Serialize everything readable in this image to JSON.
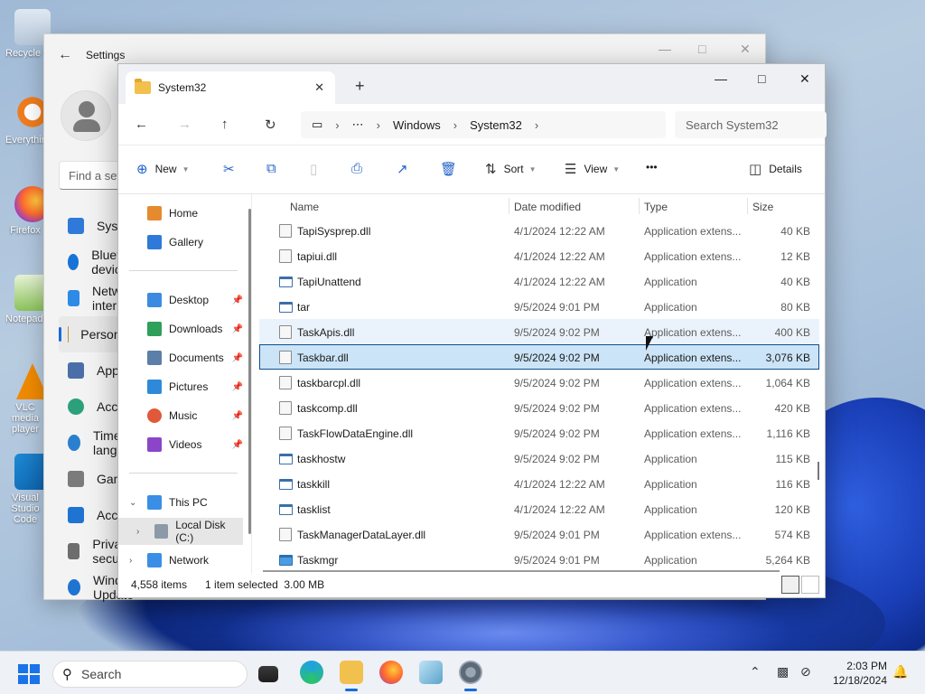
{
  "desktop": {
    "icons": [
      {
        "label": "Recycle Bin"
      },
      {
        "label": "Everything"
      },
      {
        "label": "Firefox"
      },
      {
        "label": "Notepad++"
      },
      {
        "label": "VLC media player"
      },
      {
        "label": "Visual Studio Code"
      }
    ]
  },
  "settings": {
    "title": "Settings",
    "search_placeholder": "Find a setting",
    "nav": [
      {
        "label": "System"
      },
      {
        "label": "Bluetooth & devices"
      },
      {
        "label": "Network & internet"
      },
      {
        "label": "Personalization"
      },
      {
        "label": "Apps"
      },
      {
        "label": "Accounts"
      },
      {
        "label": "Time & language"
      },
      {
        "label": "Gaming"
      },
      {
        "label": "Accessibility"
      },
      {
        "label": "Privacy & security"
      },
      {
        "label": "Windows Update"
      }
    ]
  },
  "explorer": {
    "tab_title": "System32",
    "breadcrumb": [
      "Windows",
      "System32"
    ],
    "search_placeholder": "Search System32",
    "toolbar": {
      "new": "New",
      "sort": "Sort",
      "view": "View",
      "more": "•••",
      "details": "Details"
    },
    "nav": {
      "home": "Home",
      "gallery": "Gallery",
      "desktop": "Desktop",
      "downloads": "Downloads",
      "documents": "Documents",
      "pictures": "Pictures",
      "music": "Music",
      "videos": "Videos",
      "thispc": "This PC",
      "localdisk": "Local Disk (C:)",
      "network": "Network"
    },
    "columns": {
      "name": "Name",
      "date": "Date modified",
      "type": "Type",
      "size": "Size"
    },
    "rows": [
      {
        "name": "TapiSysprep.dll",
        "date": "4/1/2024 12:22 AM",
        "type": "Application extens...",
        "size": "40 KB"
      },
      {
        "name": "tapiui.dll",
        "date": "4/1/2024 12:22 AM",
        "type": "Application extens...",
        "size": "12 KB"
      },
      {
        "name": "TapiUnattend",
        "date": "4/1/2024 12:22 AM",
        "type": "Application",
        "size": "40 KB"
      },
      {
        "name": "tar",
        "date": "9/5/2024 9:01 PM",
        "type": "Application",
        "size": "80 KB"
      },
      {
        "name": "TaskApis.dll",
        "date": "9/5/2024 9:02 PM",
        "type": "Application extens...",
        "size": "400 KB"
      },
      {
        "name": "Taskbar.dll",
        "date": "9/5/2024 9:02 PM",
        "type": "Application extens...",
        "size": "3,076 KB"
      },
      {
        "name": "taskbarcpl.dll",
        "date": "9/5/2024 9:02 PM",
        "type": "Application extens...",
        "size": "1,064 KB"
      },
      {
        "name": "taskcomp.dll",
        "date": "9/5/2024 9:02 PM",
        "type": "Application extens...",
        "size": "420 KB"
      },
      {
        "name": "TaskFlowDataEngine.dll",
        "date": "9/5/2024 9:02 PM",
        "type": "Application extens...",
        "size": "1,116 KB"
      },
      {
        "name": "taskhostw",
        "date": "9/5/2024 9:02 PM",
        "type": "Application",
        "size": "115 KB"
      },
      {
        "name": "taskkill",
        "date": "4/1/2024 12:22 AM",
        "type": "Application",
        "size": "116 KB"
      },
      {
        "name": "tasklist",
        "date": "4/1/2024 12:22 AM",
        "type": "Application",
        "size": "120 KB"
      },
      {
        "name": "TaskManagerDataLayer.dll",
        "date": "9/5/2024 9:01 PM",
        "type": "Application extens...",
        "size": "574 KB"
      },
      {
        "name": "Taskmgr",
        "date": "9/5/2024 9:01 PM",
        "type": "Application",
        "size": "5,264 KB"
      }
    ],
    "status": {
      "count": "4,558 items",
      "selection": "1 item selected  3.00 MB"
    }
  },
  "taskbar": {
    "search_placeholder": "Search",
    "time": "2:03 PM",
    "date": "12/18/2024"
  },
  "colors": {
    "accent": "#1a6ad6",
    "selected_row": "#cce4f7",
    "hover_row": "#eaf3fc"
  }
}
